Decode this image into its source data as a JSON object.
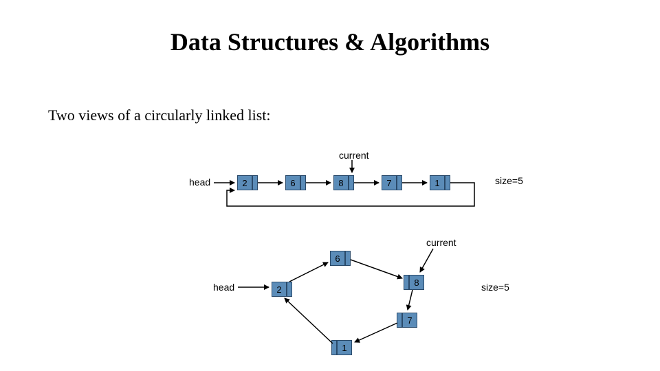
{
  "title": "Data Structures & Algorithms",
  "subtitle": "Two views of a circularly linked list:",
  "labels": {
    "head": "head",
    "current": "current",
    "size": "size=5"
  },
  "linear": {
    "nodes": [
      "2",
      "6",
      "8",
      "7",
      "1"
    ]
  },
  "circular": {
    "nodes": {
      "n6": "6",
      "n8": "8",
      "n7": "7",
      "n1": "1",
      "n2": "2"
    }
  }
}
